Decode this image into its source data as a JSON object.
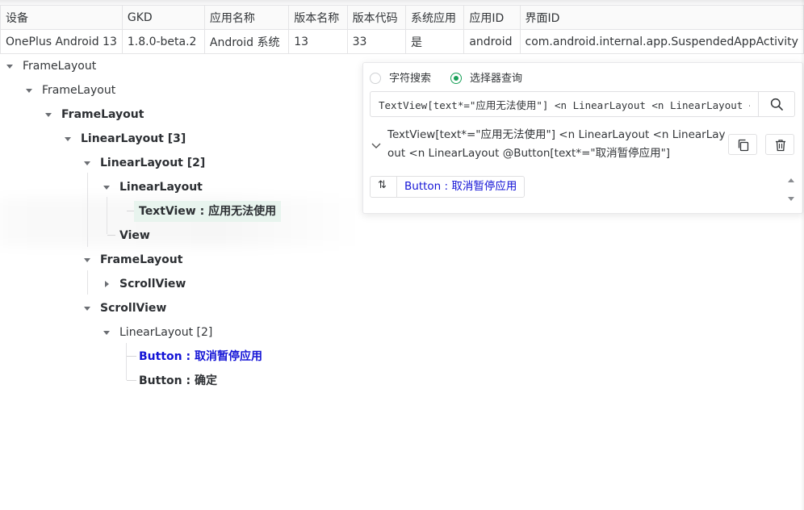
{
  "table": {
    "headers": [
      "设备",
      "GKD",
      "应用名称",
      "版本名称",
      "版本代码",
      "系统应用",
      "应用ID",
      "界面ID"
    ],
    "row": [
      "OnePlus Android 13",
      "1.8.0-beta.2",
      "Android 系统",
      "13",
      "33",
      "是",
      "android",
      "com.android.internal.app.SuspendedAppActivity"
    ]
  },
  "tree": {
    "n0": "FrameLayout",
    "n1": "FrameLayout",
    "n2": "FrameLayout",
    "n3": "LinearLayout [3]",
    "n4": "LinearLayout [2]",
    "n5": "LinearLayout",
    "n6": "TextView : 应用无法使用",
    "n7": "View",
    "n8": "FrameLayout",
    "n9": "ScrollView",
    "n10": "ScrollView",
    "n11": "LinearLayout [2]",
    "n12": "Button : 取消暂停应用",
    "n13": "Button : 确定"
  },
  "panel": {
    "radio_text": "字符搜索",
    "radio_selector": "选择器查询",
    "selected_mode": "选择器查询",
    "query_value": "TextView[text*=\"应用无法使用\"] <n LinearLayout <n LinearLayout <n LinearLayout @Button[text*=\"取消暂停应用\"]",
    "result_text": "TextView[text*=\"应用无法使用\"] <n LinearLayout <n LinearLayout <n LinearLayout @Button[text*=\"取消暂停应用\"]",
    "match_icon_text": "⇅",
    "match_label": "Button : 取消暂停应用"
  },
  "icons": {
    "search": "search-icon",
    "copy": "copy-icon",
    "delete": "trash-icon",
    "collapse": "chevron-down-icon",
    "swap": "swap-icon"
  },
  "colors": {
    "accent": "#18a058",
    "match_blue": "#1414d6",
    "selected_bg": "#e8f4ee"
  }
}
